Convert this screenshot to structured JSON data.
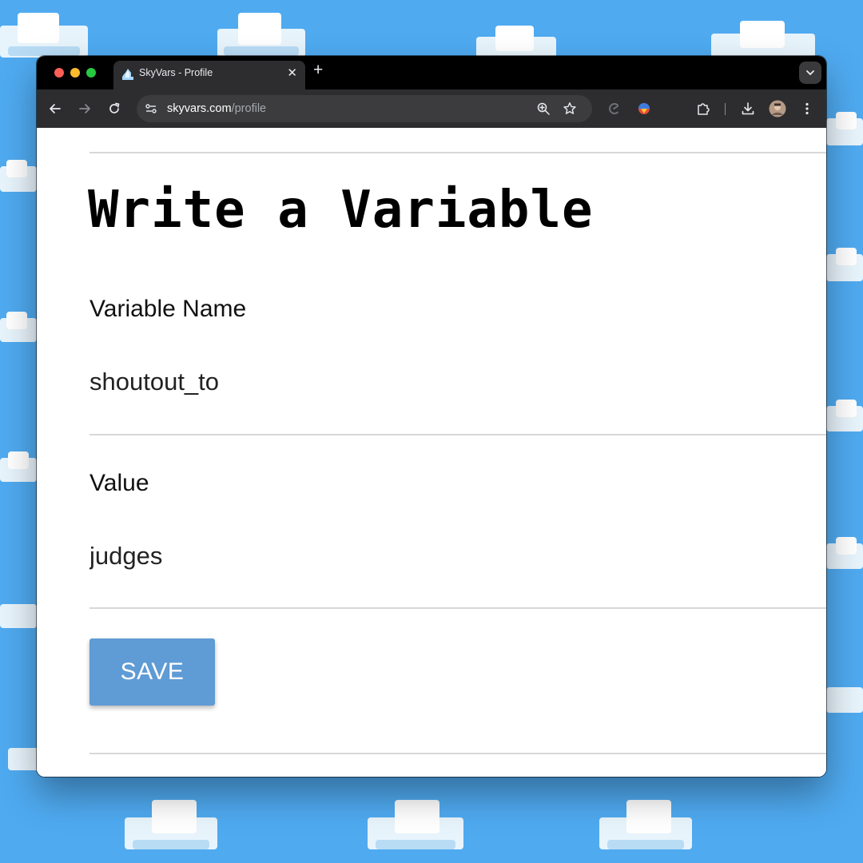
{
  "browser": {
    "tab_title": "SkyVars - Profile",
    "tab_close_glyph": "✕",
    "new_tab_glyph": "+",
    "url_host": "skyvars.com",
    "url_path": "/profile"
  },
  "page": {
    "heading": "Write a Variable",
    "variable_name_label": "Variable Name",
    "variable_name_value": "shoutout_to",
    "value_label": "Value",
    "value_value": "judges",
    "save_label": "SAVE"
  },
  "icons": {
    "favicon": "cloud-icon",
    "nav": [
      "back-arrow-icon",
      "forward-arrow-icon",
      "reload-icon"
    ],
    "omnibox": [
      "site-info-icon",
      "zoom-icon",
      "bookmark-star-icon"
    ],
    "extensions": [
      "extension-c-icon",
      "extension-colorful-icon",
      "extensions-puzzle-icon"
    ],
    "right": [
      "download-icon",
      "profile-avatar",
      "menu-dots-icon"
    ]
  },
  "colors": {
    "background": "#4faaf0",
    "button": "#5f9bd4",
    "titlebar": "#000000",
    "toolbar": "#2d2d2f"
  }
}
